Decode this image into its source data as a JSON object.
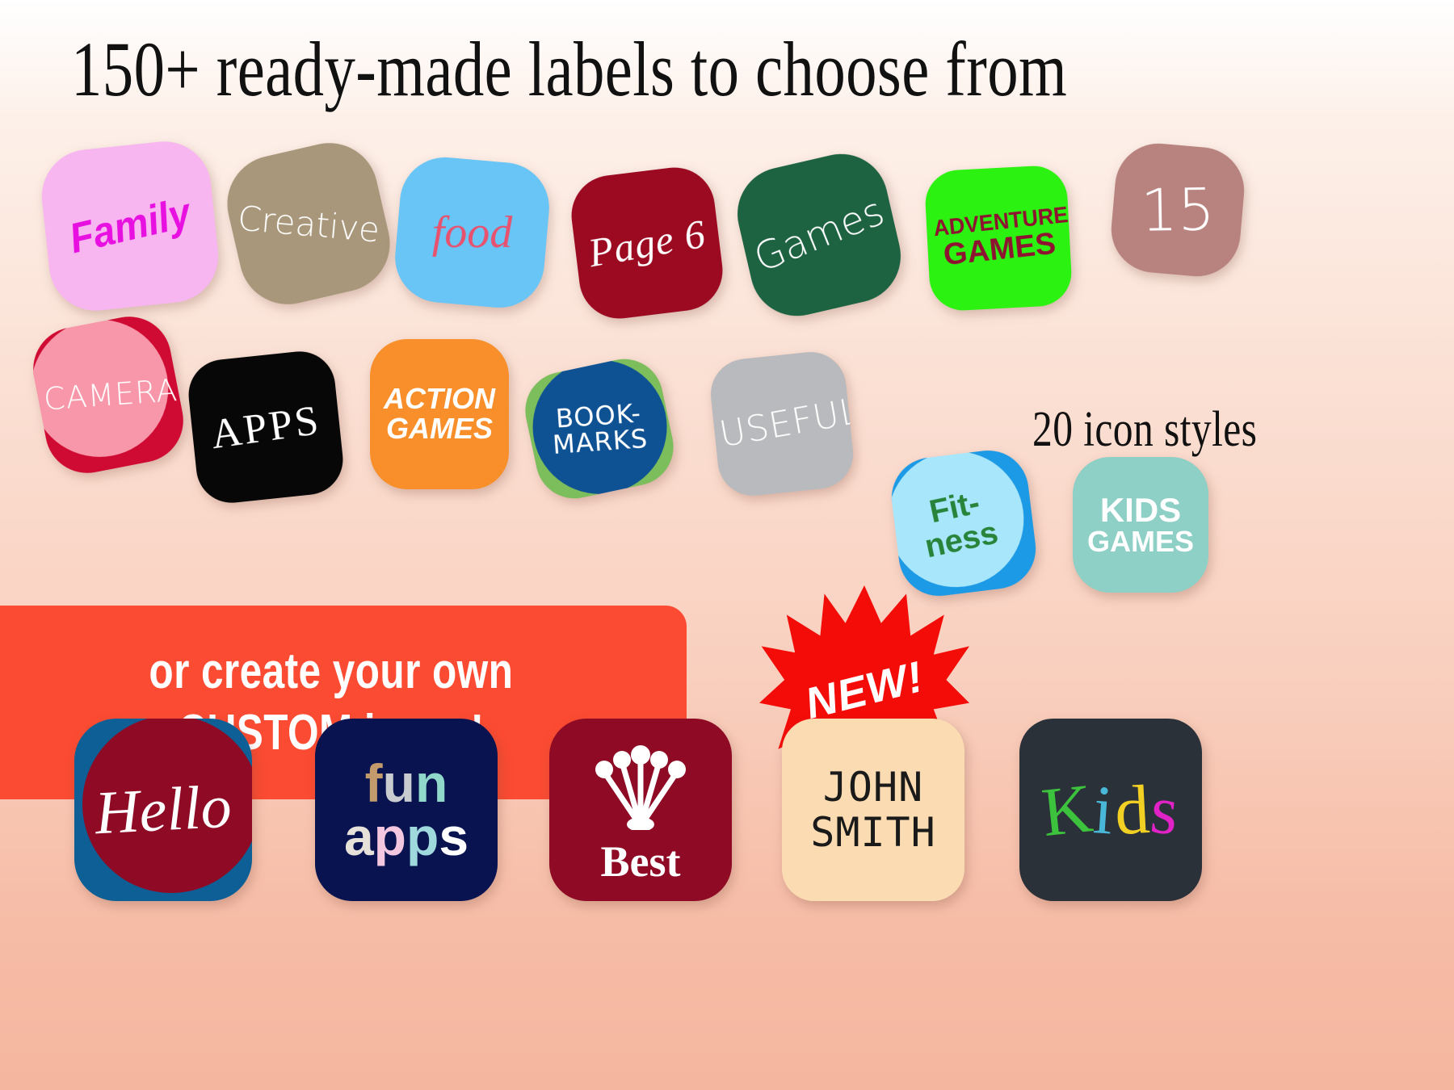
{
  "headings": {
    "title": "150+ ready-made labels to choose from",
    "styles_note": "20 icon styles"
  },
  "banner": {
    "line1": "or create your own",
    "line2": "CUSTOM icons!",
    "color": "#fb4b32"
  },
  "badge": {
    "label": "NEW!",
    "color": "#f40c08",
    "text_color": "#ffffff"
  },
  "background": {
    "top_color": "#ffffff",
    "bottom_color": "#f5b69f"
  },
  "rows": {
    "row1": [
      {
        "name": "family",
        "label": "Family",
        "bg": "#f7b6f0",
        "fg": "#e810e0",
        "rotate": -6
      },
      {
        "name": "creative",
        "label": "Creative",
        "bg": "#a8977a",
        "fg": "#ffffff",
        "rotate": -13
      },
      {
        "name": "food",
        "label": "food",
        "bg": "#68c5f5",
        "fg": "#e8526e",
        "rotate": 5
      },
      {
        "name": "page-6",
        "label": "Page 6",
        "bg": "#9c0a22",
        "fg": "#ffffff",
        "rotate": -7
      },
      {
        "name": "games",
        "label": "Games",
        "bg": "#1d6342",
        "fg": "#ffffff",
        "rotate": -13
      },
      {
        "name": "adventure-games",
        "label": "ADVENTURE GAMES",
        "line1": "ADVENTURE",
        "line2": "GAMES",
        "bg": "#2cf212",
        "fg": "#8d1331",
        "rotate": -3
      },
      {
        "name": "fifteen",
        "label": "15",
        "bg": "#b8837f",
        "fg": "#ffffff",
        "rotate": 5
      }
    ],
    "row2": [
      {
        "name": "camera",
        "label": "CAMERA",
        "bg": "#cf0a33",
        "inner": "#f797a9",
        "fg": "#ffffff",
        "rotate": -11
      },
      {
        "name": "apps",
        "label": "APPS",
        "bg": "#070707",
        "fg": "#ffffff",
        "rotate": -6
      },
      {
        "name": "action-games",
        "label": "ACTION GAMES",
        "line1": "ACTION",
        "line2": "GAMES",
        "bg": "#f88f2a",
        "fg": "#ffffff",
        "rotate": 0
      },
      {
        "name": "bookmarks",
        "label": "BOOK-MARKS",
        "line1": "BOOK-",
        "line2": "MARKS",
        "bg": "#7cbd5c",
        "inner": "#0f5293",
        "fg": "#ffffff",
        "rotate": -12
      },
      {
        "name": "useful",
        "label": "USEFUL",
        "bg": "#b9babd",
        "fg": "#ffffff",
        "rotate": -6
      },
      {
        "name": "fitness",
        "label": "Fit-ness",
        "line1": "Fit-",
        "line2": "ness",
        "bg": "#1d9ae5",
        "inner": "#a8e6fb",
        "fg": "#28843a",
        "rotate": -7
      },
      {
        "name": "kids-games",
        "label": "KIDS GAMES",
        "line1": "KIDS",
        "line2": "GAMES",
        "bg": "#8ecfc6",
        "fg": "#ffffff",
        "rotate": 0
      }
    ],
    "row3": [
      {
        "name": "hello",
        "label": "Hello",
        "bg": "#0d5f96",
        "inner": "#8e0a25",
        "fg": "#ffffff"
      },
      {
        "name": "fun-apps",
        "label": "fun apps",
        "letters_line1": [
          {
            "ch": "f",
            "color": "#c39a6b"
          },
          {
            "ch": "u",
            "color": "#c9ccce"
          },
          {
            "ch": "n",
            "color": "#8fd8ca"
          }
        ],
        "letters_line2": [
          {
            "ch": "a",
            "color": "#e6e2da"
          },
          {
            "ch": "p",
            "color": "#f3c7e0"
          },
          {
            "ch": "p",
            "color": "#9fd9de"
          },
          {
            "ch": "s",
            "color": "#ffffff"
          }
        ],
        "bg": "#081350"
      },
      {
        "name": "best",
        "label": "Best",
        "icon": "crown-icon",
        "bg": "#8e0a25",
        "fg": "#ffffff"
      },
      {
        "name": "john-smith",
        "label": "JOHN SMITH",
        "line1": "JOHN",
        "line2": "SMITH",
        "bg": "#fbdcb2",
        "fg": "#1a1a1a"
      },
      {
        "name": "kids",
        "label": "Kids",
        "letters": [
          {
            "ch": "K",
            "color": "#3cc23c"
          },
          {
            "ch": "i",
            "color": "#49b8d8"
          },
          {
            "ch": "d",
            "color": "#f2d023"
          },
          {
            "ch": "s",
            "color": "#e022c6"
          }
        ],
        "bg": "#2b3139"
      }
    ]
  }
}
